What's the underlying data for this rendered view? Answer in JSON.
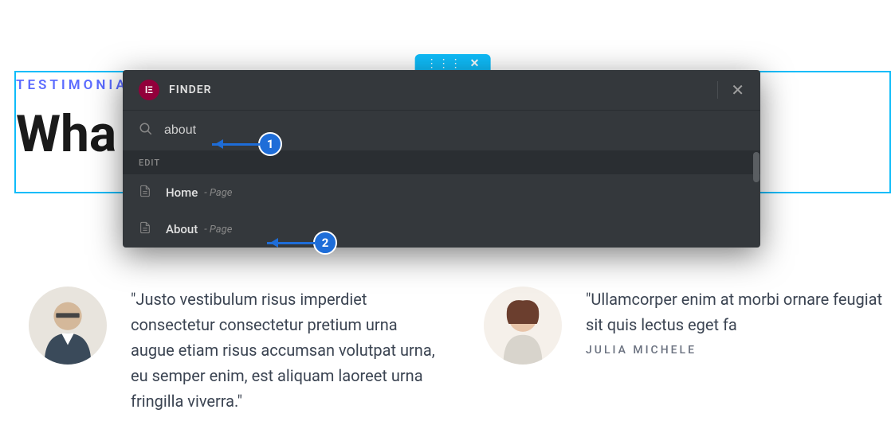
{
  "section": {
    "label": "TESTIMONIA",
    "heading": "Wha"
  },
  "editor_handle": {
    "dots": "⋮⋮⋮",
    "close": "✕"
  },
  "finder": {
    "title": "FINDER",
    "logo": "lΞ",
    "close": "✕",
    "search_value": "about",
    "category": "EDIT",
    "items": [
      {
        "name": "Home",
        "type": "- Page"
      },
      {
        "name": "About",
        "type": "- Page"
      }
    ]
  },
  "callouts": {
    "one": "1",
    "two": "2"
  },
  "testimonials": [
    {
      "quote": "\"Justo vestibulum risus imperdiet consectetur consectetur pretium urna augue etiam risus accumsan volutpat urna, eu semper enim, est aliquam laoreet urna fringilla viverra.\"",
      "author": ""
    },
    {
      "quote": "\"Ullamcorper enim at morbi ornare feugiat sit quis lectus eget fa",
      "author": "JULIA MICHELE"
    }
  ]
}
